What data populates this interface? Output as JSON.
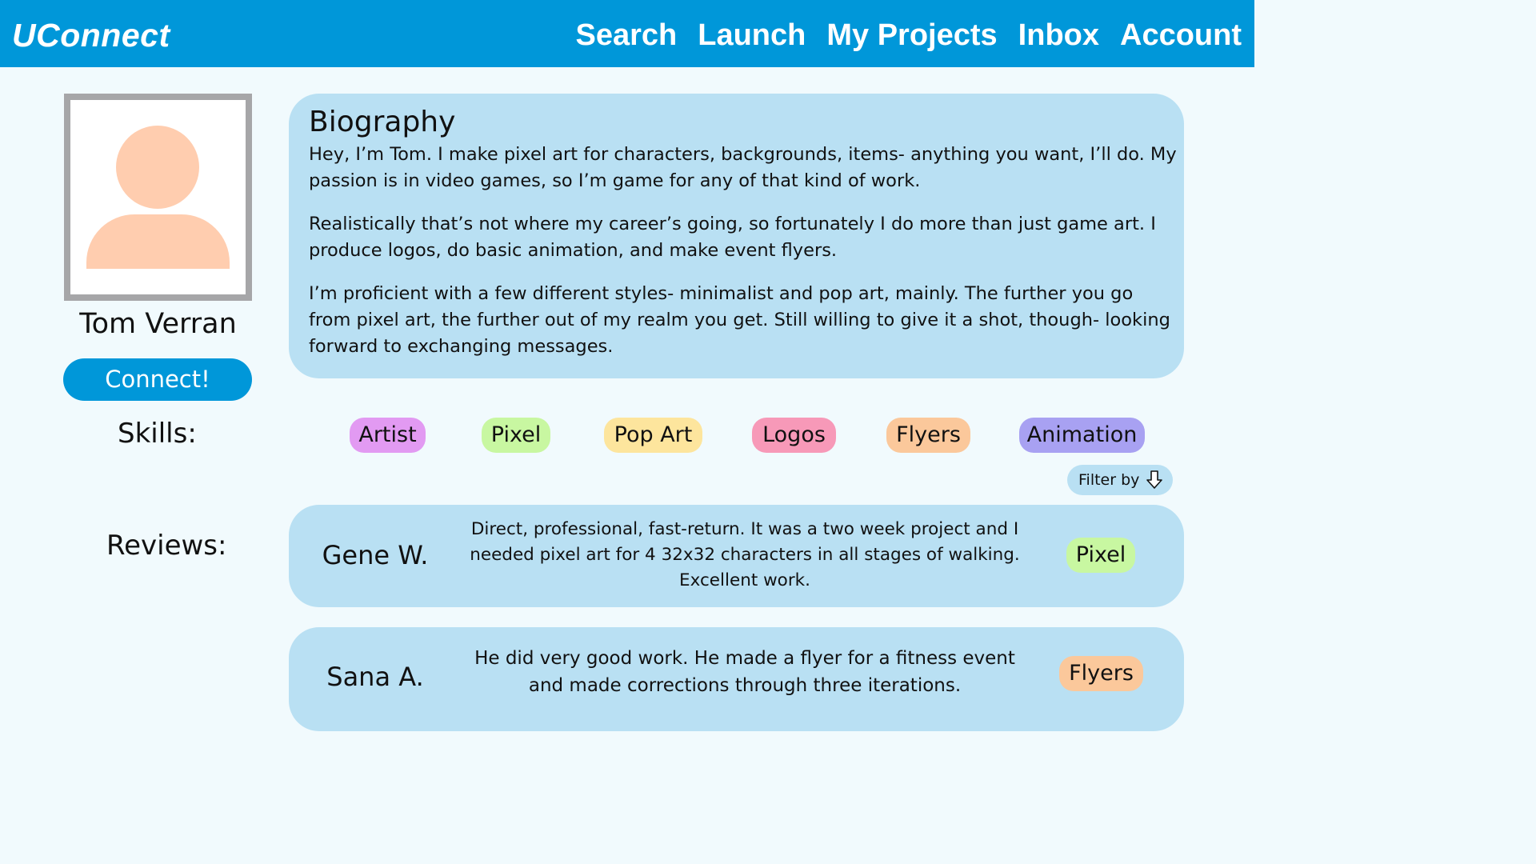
{
  "app": {
    "title": "UConnect"
  },
  "nav": {
    "items": [
      "Search",
      "Launch",
      "My Projects",
      "Inbox",
      "Account"
    ]
  },
  "profile": {
    "name": "Tom Verran",
    "connect_label": "Connect!"
  },
  "biography": {
    "title": "Biography",
    "paragraphs": [
      "Hey, I’m Tom. I make pixel art for characters, backgrounds, items- anything you want, I’ll do. My passion is in video games, so I’m game for any of that kind of work.",
      "Realistically that’s not where my career’s going, so fortunately I do more than just game art. I produce logos, do basic animation, and make event flyers.",
      "I’m proficient with a few different styles- minimalist and pop art, mainly. The further you go from pixel art, the further out of my realm you get. Still willing to give it a shot, though- looking forward to exchanging messages."
    ]
  },
  "skills": {
    "label": "Skills:",
    "tags": [
      {
        "label": "Artist",
        "color": "#e29af2"
      },
      {
        "label": "Pixel",
        "color": "#c8f7a1"
      },
      {
        "label": "Pop Art",
        "color": "#fde59d"
      },
      {
        "label": "Logos",
        "color": "#f799b8"
      },
      {
        "label": "Flyers",
        "color": "#fbc89b"
      },
      {
        "label": "Animation",
        "color": "#a8a1f2"
      }
    ]
  },
  "filter": {
    "label": "Filter by",
    "icon": "arrow-down-icon"
  },
  "reviews": {
    "label": "Reviews:",
    "items": [
      {
        "reviewer": "Gene W.",
        "text": "Direct, professional, fast-return. It was a two week project and I needed pixel art for 4 32x32 characters in all stages of walking. Excellent work.",
        "tag": "Pixel",
        "tag_color": "#c8f7a1"
      },
      {
        "reviewer": "Sana A.",
        "text": "He did very good work. He made a flyer for a fitness event and made corrections through three iterations.",
        "tag": "Flyers",
        "tag_color": "#fbc89b"
      }
    ]
  },
  "colors": {
    "brand": "#0097d9",
    "card": "#b9e0f3",
    "background": "#f1fafd",
    "avatar": "#ffcdaf"
  }
}
